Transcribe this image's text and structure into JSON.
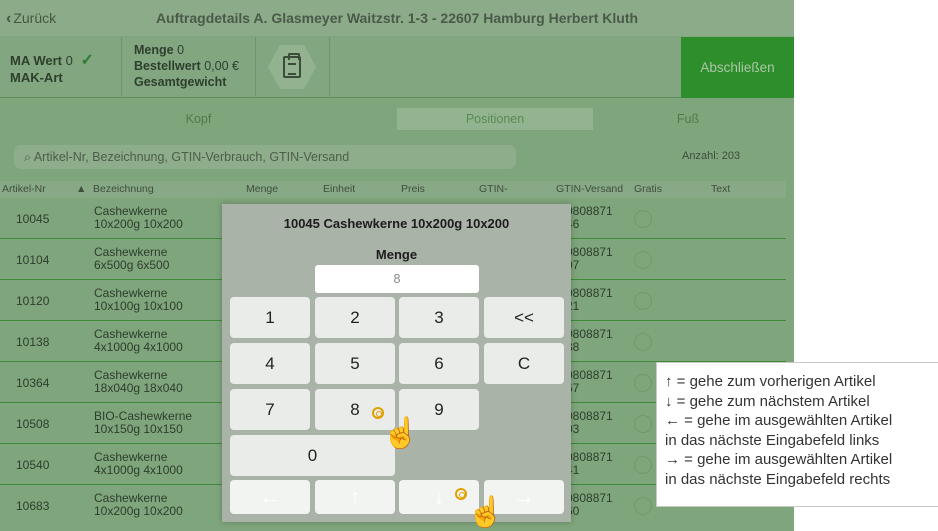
{
  "header": {
    "back_label": "Zurück",
    "title": "Auftragdetails A. Glasmeyer Waitzstr. 1-3 - 22607 Hamburg Herbert Kluth"
  },
  "info": {
    "ma_wert_label": "MA Wert",
    "ma_wert_value": "0",
    "mak_art_label": "MAK-Art",
    "menge_label": "Menge",
    "menge_value": "0",
    "bestellwert_label": "Bestellwert",
    "bestellwert_value": "0,00 €",
    "gesamtgewicht_label": "Gesamtgewicht",
    "finish_label": "Abschließen"
  },
  "tabs": [
    "Kopf",
    "Positionen",
    "Fuß"
  ],
  "active_tab": "Positionen",
  "search": {
    "placeholder": "Artikel-Nr, Bezeichnung, GTIN-Verbrauch, GTIN-Versand",
    "count_label": "Anzahl: 203"
  },
  "table": {
    "columns": [
      "Artikel-Nr",
      "Bezeichnung",
      "Menge",
      "Einheit",
      "Preis",
      "GTIN-",
      "GTIN-Versand",
      "Gratis",
      "Text"
    ],
    "rows": [
      {
        "nr": "10045",
        "bez1": "Cashewkerne",
        "bez2": "10x200g 10x200",
        "gtin1": "0808871",
        "gtin2": "46"
      },
      {
        "nr": "10104",
        "bez1": "Cashewkerne",
        "bez2": "6x500g 6x500",
        "gtin1": "0808871",
        "gtin2": "07"
      },
      {
        "nr": "10120",
        "bez1": "Cashewkerne",
        "bez2": "10x100g 10x100",
        "gtin1": "0808871",
        "gtin2": "21"
      },
      {
        "nr": "10138",
        "bez1": "Cashewkerne",
        "bez2": "4x1000g 4x1000",
        "gtin1": "0808871",
        "gtin2": "38"
      },
      {
        "nr": "10364",
        "bez1": "Cashewkerne",
        "bez2": "18x040g 18x040",
        "gtin1": "0808871",
        "gtin2": "67"
      },
      {
        "nr": "10508",
        "bez1": "BIO-Cashewkerne",
        "bez2": "10x150g 10x150",
        "gtin1": "0808871",
        "gtin2": "03"
      },
      {
        "nr": "10540",
        "bez1": "Cashewkerne",
        "bez2": "4x1000g 4x1000",
        "gtin1": "0808871",
        "gtin2": "41"
      },
      {
        "nr": "10683",
        "bez1": "Cashewkerne",
        "bez2": "10x200g 10x200",
        "gtin1": "0808871",
        "gtin2": "60"
      }
    ]
  },
  "modal": {
    "title": "10045 Cashewkerne 10x200g 10x200",
    "field_label": "Menge",
    "field_value": "8",
    "keys": [
      "1",
      "2",
      "3",
      "<<",
      "4",
      "5",
      "6",
      "C",
      "7",
      "8",
      "9",
      "0"
    ],
    "arrows": [
      "←",
      "↑",
      "↓",
      "→"
    ]
  },
  "legend": {
    "lines": [
      "↑ = gehe zum vorherigen Artikel",
      "↓ = gehe zum nächstem Artikel",
      "← = gehe im ausgewählten Artikel",
      "in das nächste Eingabefeld links",
      "→ = gehe im ausgewählten Artikel",
      "in das nächste Eingabefeld rechts"
    ]
  }
}
